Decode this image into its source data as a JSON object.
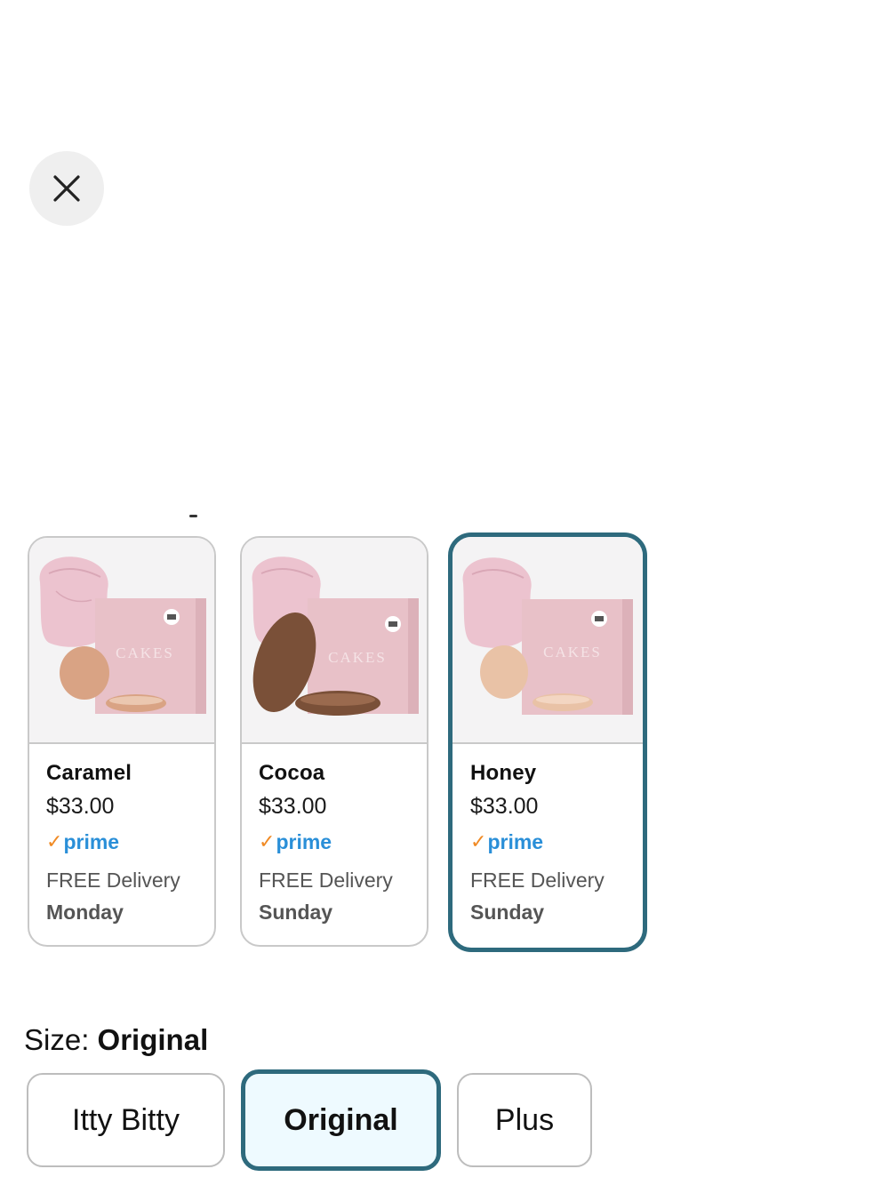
{
  "close": {
    "icon": "close-icon"
  },
  "colors": [
    {
      "name": "Caramel",
      "price": "$33.00",
      "prime": "prime",
      "delivery": "FREE Delivery",
      "day": "Monday",
      "tone": "#d9a384",
      "brand": "CAKES",
      "selected": false
    },
    {
      "name": "Cocoa",
      "price": "$33.00",
      "prime": "prime",
      "delivery": "FREE Delivery",
      "day": "Sunday",
      "tone": "#7a5038",
      "brand": "CAKES",
      "selected": false
    },
    {
      "name": "Honey",
      "price": "$33.00",
      "prime": "prime",
      "delivery": "FREE Delivery",
      "day": "Sunday",
      "tone": "#e9c2a6",
      "brand": "CAKES",
      "selected": true
    }
  ],
  "size": {
    "label": "Size: ",
    "value": "Original",
    "options": [
      "Itty Bitty",
      "Original",
      "Plus"
    ],
    "selected_index": 1
  },
  "colors_palette": {
    "selected_border": "#2e6a7d",
    "selected_fill": "#eefaff",
    "prime_blue": "#2a8fd8",
    "prime_check": "#f08a24"
  }
}
